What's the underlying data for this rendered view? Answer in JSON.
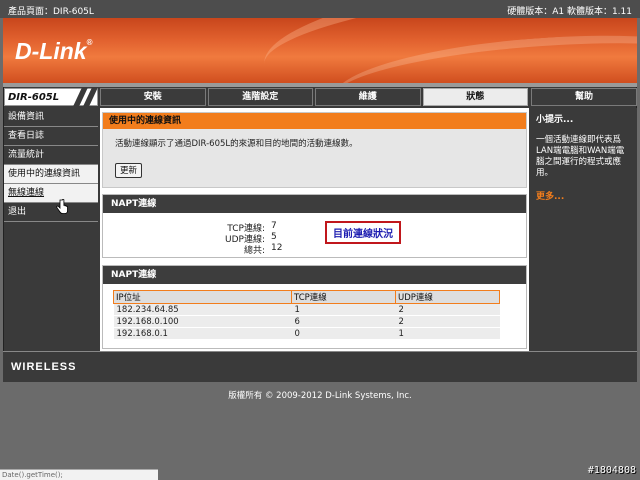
{
  "topbar": {
    "product": "產品頁面：DIR-605L",
    "versions": "硬體版本：A1   軟體版本：1.11"
  },
  "brand": {
    "logo": "D-Link",
    "reg_mark": "®",
    "model": "DIR-605L"
  },
  "tabs": [
    {
      "label": "安裝",
      "active": false
    },
    {
      "label": "進階設定",
      "active": false
    },
    {
      "label": "維護",
      "active": false
    },
    {
      "label": "狀態",
      "active": true
    }
  ],
  "help_tab": "幫助",
  "sidebar": {
    "items": [
      {
        "label": "設備資訊",
        "state": "normal"
      },
      {
        "label": "查看日誌",
        "state": "normal"
      },
      {
        "label": "流量統計",
        "state": "normal"
      },
      {
        "label": "使用中的連線資訊",
        "state": "active"
      },
      {
        "label": "無線連線",
        "state": "hover"
      },
      {
        "label": "退出",
        "state": "normal"
      }
    ]
  },
  "info": {
    "title": "使用中的連線資訊",
    "text": "活動連線顯示了通過DIR-605L的來源和目的地間的活動連線數。",
    "refresh_label": "更新"
  },
  "napt_stats": {
    "title": "NAPT連線",
    "tcp_label": "TCP連線:",
    "tcp_value": "7",
    "udp_label": "UDP連線:",
    "udp_value": "5",
    "total_label": "總共:",
    "total_value": "12",
    "annotation": "目前連線狀況"
  },
  "napt_table": {
    "title": "NAPT連線",
    "headers": [
      "IP位址",
      "TCP連線",
      "UDP連線"
    ],
    "rows": [
      [
        "182.234.64.85",
        "1",
        "2"
      ],
      [
        "192.168.0.100",
        "6",
        "2"
      ],
      [
        "192.168.0.1",
        "0",
        "1"
      ]
    ]
  },
  "help_panel": {
    "title": "小提示...",
    "text": "一個活動連線即代表爲LAN端電腦和WAN端電腦之間運行的程式或應用。",
    "more": "更多..."
  },
  "footer": {
    "wireless": "WIRELESS",
    "copyright": "版權所有 © 2009-2012 D-Link Systems, Inc."
  },
  "statusbar": {
    "text": "Date().getTime();"
  },
  "watermark": "#1804808",
  "colors": {
    "accent": "#f27d1c",
    "annotation_border": "#c0171c",
    "annotation_text": "#1c1cb0"
  }
}
